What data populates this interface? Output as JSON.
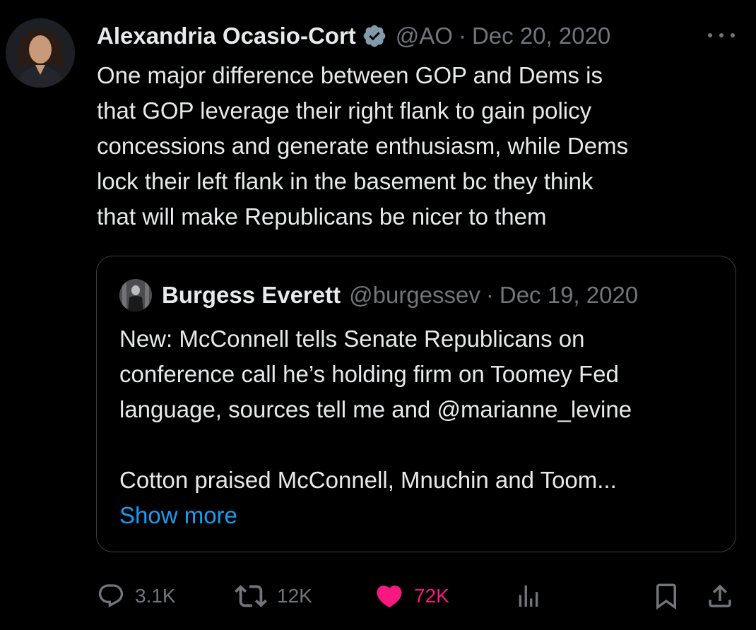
{
  "tweet": {
    "author": {
      "display_name": "Alexandria Ocasio-Cort",
      "handle": "@AO",
      "verified": true
    },
    "separator": "·",
    "date": "Dec 20, 2020",
    "text_lines": [
      "One major difference between GOP and Dems is",
      "that GOP leverage their right flank to gain policy",
      "concessions and generate enthusiasm, while Dems",
      "lock their left flank in the basement bc they think",
      "that will make Republicans be nicer to them"
    ]
  },
  "quote": {
    "author": {
      "display_name": "Burgess Everett",
      "handle": "@burgessev"
    },
    "separator": "·",
    "date": "Dec 19, 2020",
    "text_lines": [
      "New: McConnell tells Senate Republicans on",
      "conference call he’s holding firm on Toomey Fed",
      "language, sources tell me and @marianne_levine"
    ],
    "text_line_after_break": "Cotton praised McConnell, Mnuchin and Toom...",
    "show_more_label": "Show more"
  },
  "actions": {
    "reply": {
      "icon": "reply-icon",
      "count": "3.1K"
    },
    "retweet": {
      "icon": "retweet-icon",
      "count": "12K"
    },
    "like": {
      "icon": "heart-icon",
      "count": "72K",
      "liked": true,
      "color": "#f91880"
    },
    "views": {
      "icon": "analytics-icon"
    },
    "bookmark": {
      "icon": "bookmark-icon"
    },
    "share": {
      "icon": "share-icon"
    }
  },
  "colors": {
    "background": "#000000",
    "text_primary": "#e7e9ea",
    "text_secondary": "#71767b",
    "link": "#1d9bf0",
    "verified": "#829aab",
    "border": "#3a3f44"
  }
}
